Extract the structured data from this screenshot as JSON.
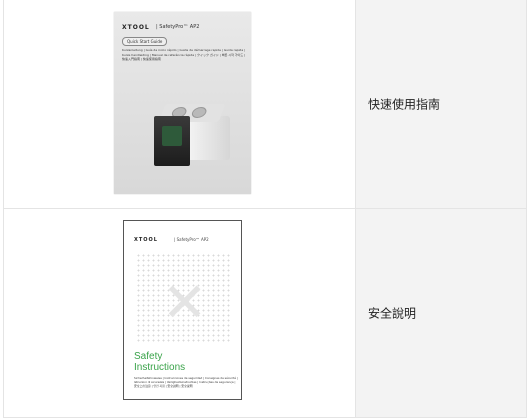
{
  "rows": [
    {
      "label": "快速使用指南",
      "cover": {
        "brand": "XTOOL",
        "product": "| SafetyPro™ AP2",
        "pill": "Quick Start Guide",
        "languages": "Kurzanleitung | Guía de inicio rápido | Guide de démarrage rapide | Guida rapida | Kurze handleiding | Manual de referência rápida | クイック ガイド | 빠른 시작 가이드 | 快速入門指南 | 快速使用指南"
      }
    },
    {
      "label": "安全說明",
      "cover": {
        "brand": "XTOOL",
        "product": "| SafetyPro™ AP2",
        "title_line1": "Safety",
        "title_line2": "Instructions",
        "languages": "Sicherheitshinweise | Instrucciones de seguridad | Consignes de sécurité | Istruzioni di sicurezza | Veiligheidsinstructies | Instruções de segurança | 安全上の注意 | 안전 지침 | 安全說明 | 安全说明"
      }
    }
  ]
}
